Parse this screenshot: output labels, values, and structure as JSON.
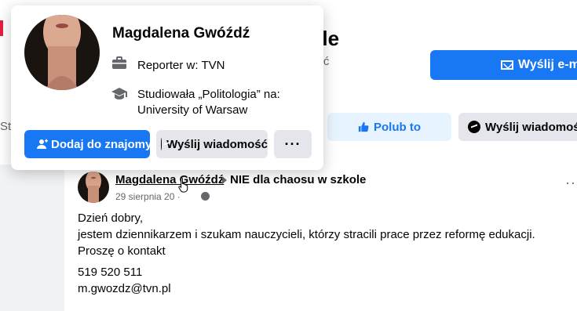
{
  "background": {
    "group_title_partial": "kole",
    "group_sub_partial": "ość",
    "email_button": "Wyślij e-m",
    "left_text_partial": "St",
    "like_button": "Polub to",
    "message_button": "Wyślij wiadomość"
  },
  "post": {
    "author": "Magdalena Gwóźdź",
    "group": "NIE dla chaosu w szkole",
    "date": "29 sierpnia 20",
    "body": [
      "Dzień dobry,",
      "jestem dziennikarzem i szukam nauczycieli, którzy stracili prace przez reformę edukacji.",
      "Proszę o kontakt"
    ],
    "contact": [
      "519 520 511",
      "m.gwozdz@tvn.pl"
    ]
  },
  "hover_card": {
    "name": "Magdalena Gwóźdź",
    "work_prefix": "Reporter w: ",
    "work_place": "TVN",
    "edu_line1": "Studiowała „Politologia” na:",
    "edu_line2": "University of Warsaw",
    "add_friend_label": "Dodaj do znajomych",
    "message_label": "Wyślij wiadomość",
    "more_label": "···"
  },
  "colors": {
    "primary": "#1877f2",
    "light_primary": "#e7f3ff",
    "button_gray": "#e4e6eb",
    "secondary_text": "#65676b"
  },
  "icons": [
    "briefcase-icon",
    "graduation-cap-icon",
    "add-friend-icon",
    "messenger-icon",
    "thumbs-up-icon",
    "envelope-icon",
    "globe-icon",
    "more-dots-icon",
    "hand-cursor-icon"
  ]
}
